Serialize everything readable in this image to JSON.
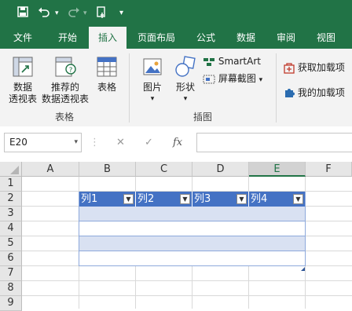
{
  "qat": {
    "save_icon": "save-icon",
    "undo_icon": "undo-icon",
    "redo_icon": "redo-icon",
    "touch_icon": "touch-mode-icon",
    "customize_icon": "customize-icon"
  },
  "tabs": [
    {
      "label": "文件",
      "active": false
    },
    {
      "label": "开始",
      "active": false
    },
    {
      "label": "插入",
      "active": true
    },
    {
      "label": "页面布局",
      "active": false
    },
    {
      "label": "公式",
      "active": false
    },
    {
      "label": "数据",
      "active": false
    },
    {
      "label": "审阅",
      "active": false
    },
    {
      "label": "视图",
      "active": false
    }
  ],
  "ribbon": {
    "pivot_table": "数据\n透视表",
    "pivot_table_l1": "数据",
    "pivot_table_l2": "透视表",
    "recommended_pivot_l1": "推荐的",
    "recommended_pivot_l2": "数据透视表",
    "table": "表格",
    "tables_group": "表格",
    "pictures": "图片",
    "shapes": "形状",
    "smartart": "SmartArt",
    "screenshot": "屏幕截图",
    "illustrations_group": "插图",
    "get_addins": "获取加载项",
    "my_addins": "我的加载项"
  },
  "formula_bar": {
    "name_box": "E20",
    "fx": "fx",
    "formula": ""
  },
  "columns": [
    "A",
    "B",
    "C",
    "D",
    "E",
    "F"
  ],
  "rows": [
    "1",
    "2",
    "3",
    "4",
    "5",
    "6",
    "7",
    "8",
    "9"
  ],
  "table_headers": [
    "列1",
    "列2",
    "列3",
    "列4"
  ],
  "colors": {
    "accent": "#217346",
    "table_header": "#4472c4",
    "band": "#d9e1f2"
  }
}
